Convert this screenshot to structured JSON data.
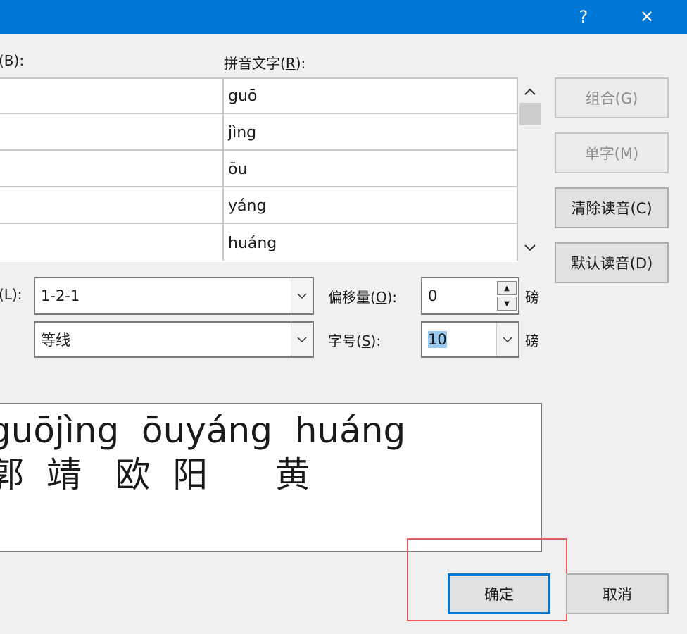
{
  "window": {
    "help_label": "?",
    "close_label": "✕"
  },
  "labels": {
    "base_text": "(B):",
    "ruby_text_prefix": "拼音文字(",
    "ruby_text_key": "R",
    "ruby_text_suffix": "):",
    "alignment": "(L):",
    "offset_prefix": "偏移量(",
    "offset_key": "O",
    "offset_suffix": "):",
    "size_prefix": "字号(",
    "size_key": "S",
    "size_suffix": "):",
    "unit_offset": "磅",
    "unit_size": "磅"
  },
  "ruby_rows": [
    "guō",
    "jìng",
    "ōu",
    "yáng",
    "huáng"
  ],
  "fields": {
    "alignment_value": "1-2-1",
    "font_value": "等线",
    "offset_value": "0",
    "size_value": "10"
  },
  "buttons": {
    "group": "组合(G)",
    "single": "单字(M)",
    "clear": "清除读音(C)",
    "default": "默认读音(D)",
    "ok": "确定",
    "cancel": "取消"
  },
  "preview": {
    "pinyin_line": "guōjìng  ōuyáng  huáng",
    "hanzi_line": "郭  靖   欧  阳      黄"
  }
}
